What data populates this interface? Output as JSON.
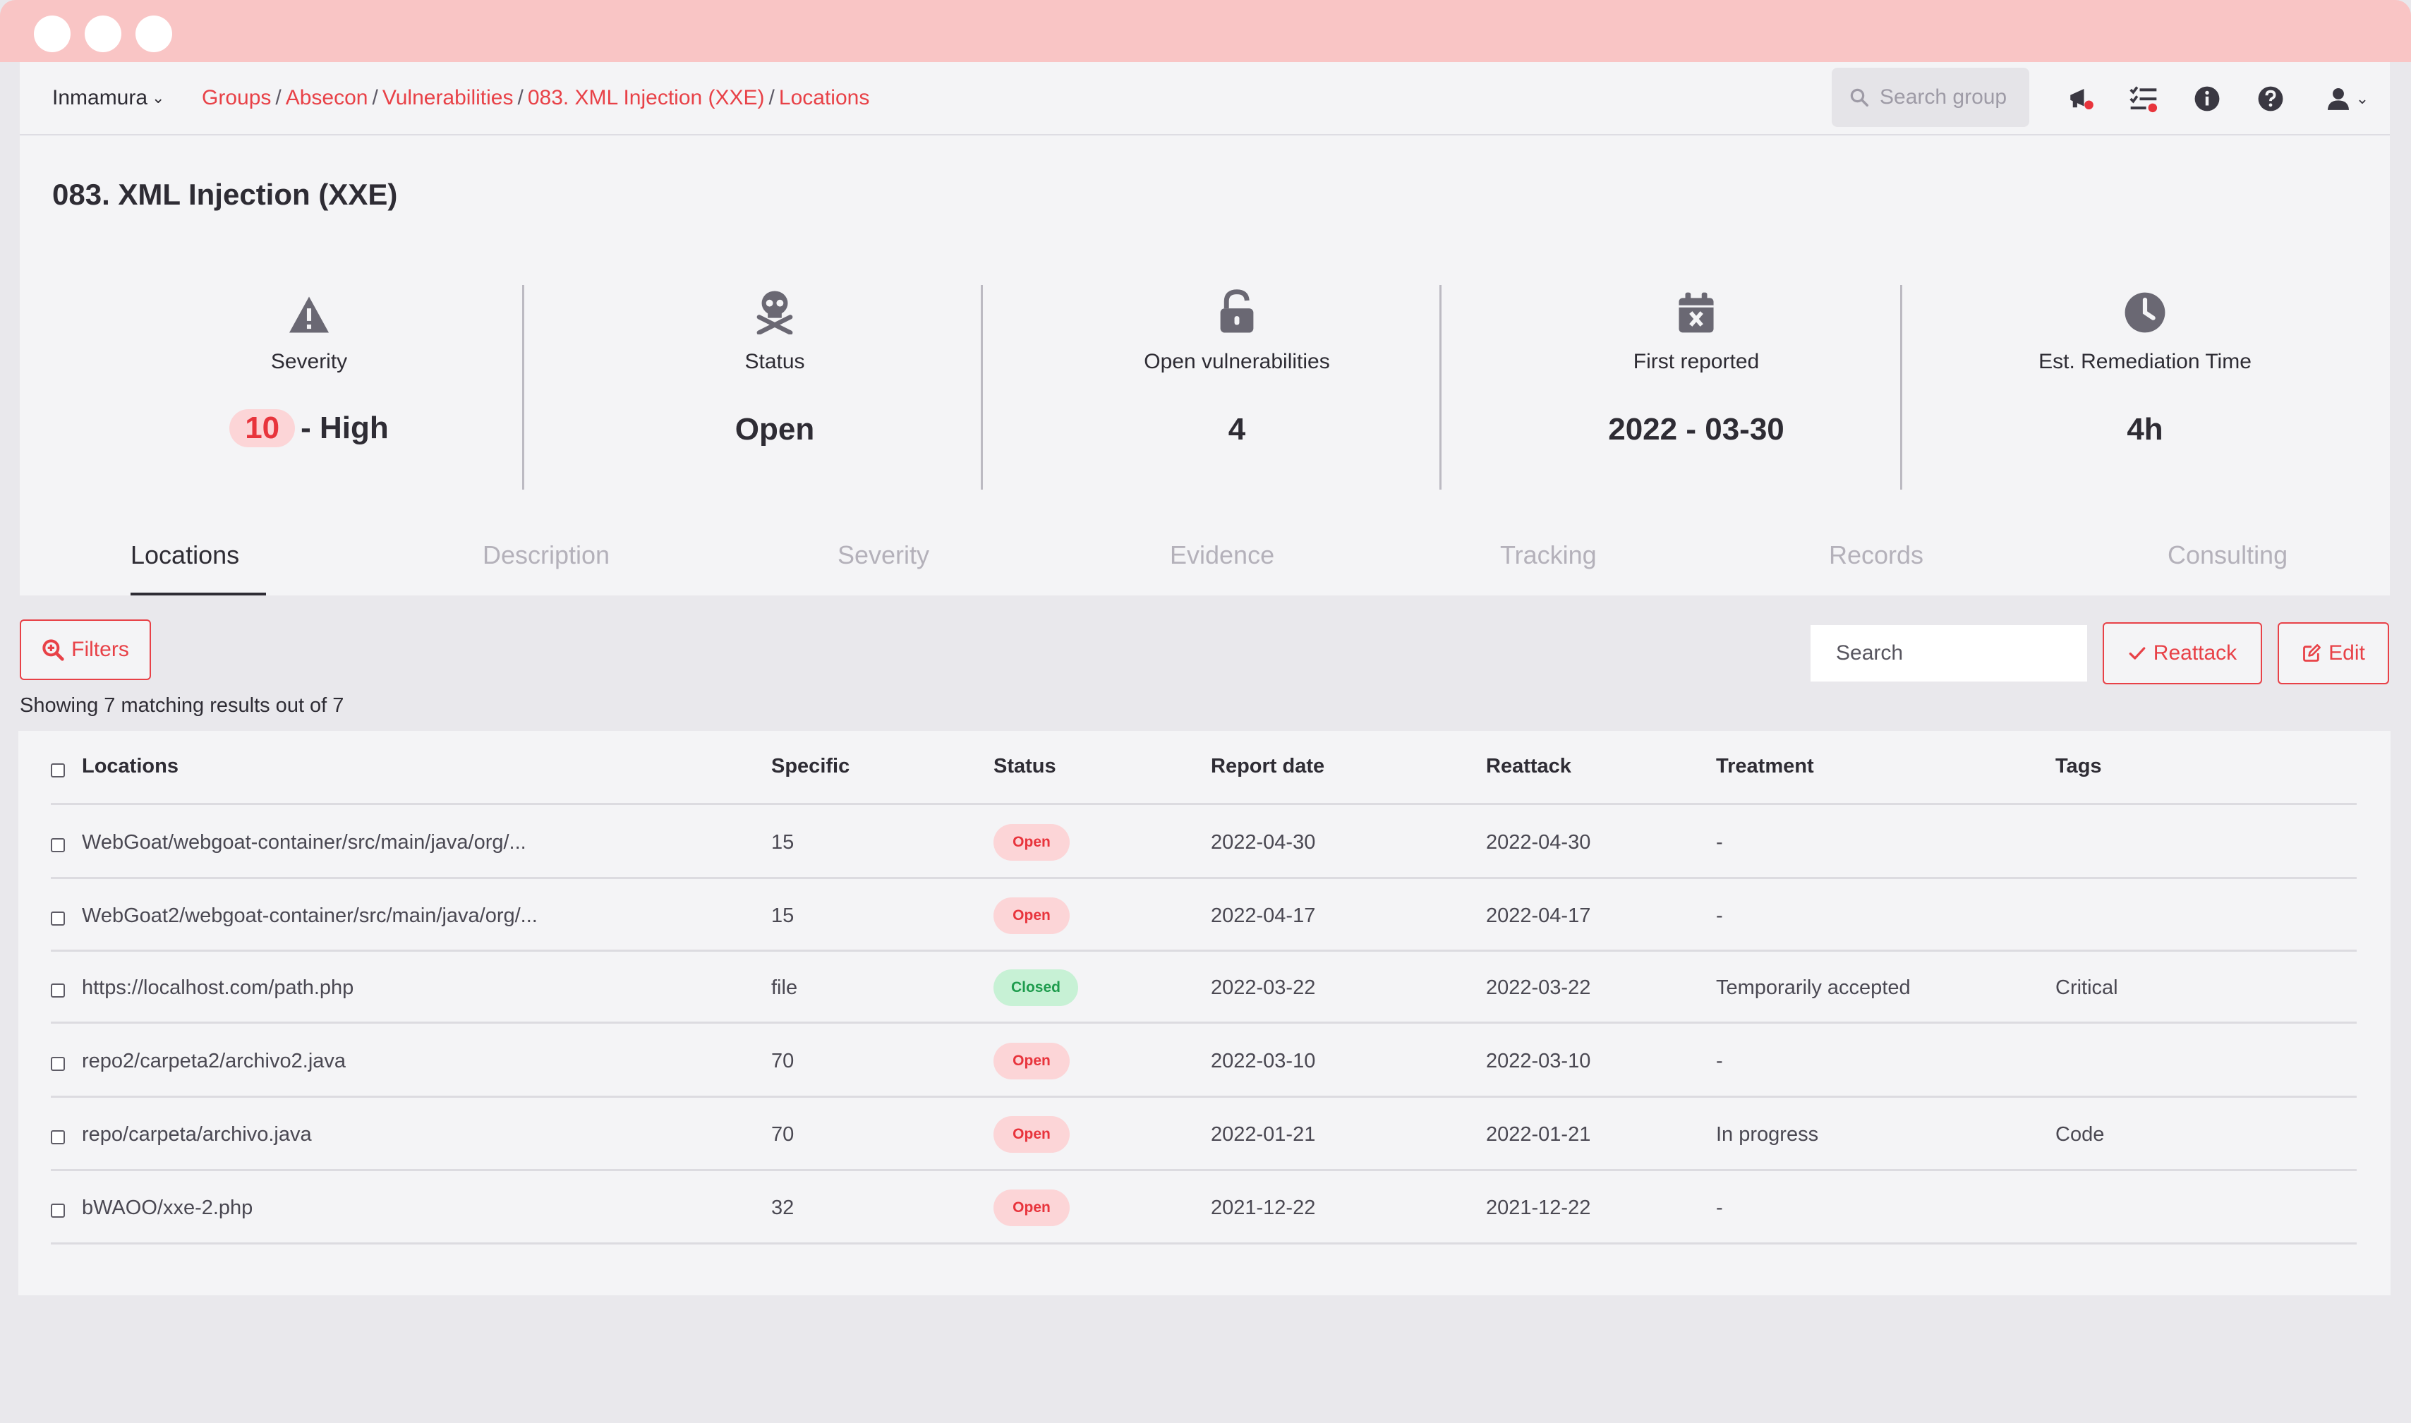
{
  "window": {
    "controls": [
      "close",
      "minimize",
      "maximize"
    ]
  },
  "topbar": {
    "organization": "Inmamura",
    "breadcrumb": [
      "Groups",
      "Absecon",
      "Vulnerabilities",
      "083. XML Injection (XXE)",
      "Locations"
    ],
    "search_placeholder": "Search group",
    "icons": [
      "announcement-icon",
      "tasks-icon",
      "info-icon",
      "help-icon",
      "user-icon"
    ]
  },
  "vulnerability": {
    "title": "083. XML Injection (XXE)",
    "indicators": {
      "severity": {
        "label": "Severity",
        "score": "10",
        "level": "- High"
      },
      "status": {
        "label": "Status",
        "value": "Open"
      },
      "open_vulns": {
        "label": "Open vulnerabilities",
        "value": "4"
      },
      "first_reported": {
        "label": "First reported",
        "value": "2022 - 03-30"
      },
      "remediation": {
        "label": "Est. Remediation Time",
        "value": "4h"
      }
    }
  },
  "tabs": [
    "Locations",
    "Description",
    "Severity",
    "Evidence",
    "Tracking",
    "Records",
    "Consulting"
  ],
  "active_tab": "Locations",
  "toolbar": {
    "filters_label": "Filters",
    "results_text": "Showing 7 matching results out of 7",
    "search_placeholder": "Search",
    "reattack_label": "Reattack",
    "edit_label": "Edit"
  },
  "table": {
    "columns": [
      "Locations",
      "Specific",
      "Status",
      "Report date",
      "Reattack",
      "Treatment",
      "Tags"
    ],
    "rows": [
      {
        "location": "WebGoat/webgoat-container/src/main/java/org/...",
        "specific": "15",
        "status": "Open",
        "report_date": "2022-04-30",
        "reattack": "2022-04-30",
        "treatment": "-",
        "tags": ""
      },
      {
        "location": "WebGoat2/webgoat-container/src/main/java/org/...",
        "specific": "15",
        "status": "Open",
        "report_date": "2022-04-17",
        "reattack": "2022-04-17",
        "treatment": "-",
        "tags": ""
      },
      {
        "location": "https://localhost.com/path.php",
        "specific": "file",
        "status": "Closed",
        "report_date": "2022-03-22",
        "reattack": "2022-03-22",
        "treatment": "Temporarily accepted",
        "tags": "Critical"
      },
      {
        "location": "repo2/carpeta2/archivo2.java",
        "specific": "70",
        "status": "Open",
        "report_date": "2022-03-10",
        "reattack": "2022-03-10",
        "treatment": "-",
        "tags": ""
      },
      {
        "location": "repo/carpeta/archivo.java",
        "specific": "70",
        "status": "Open",
        "report_date": "2022-01-21",
        "reattack": "2022-01-21",
        "treatment": "In progress",
        "tags": "Code"
      },
      {
        "location": "bWAOO/xxe-2.php",
        "specific": "32",
        "status": "Open",
        "report_date": "2021-12-22",
        "reattack": "2021-12-22",
        "treatment": "-",
        "tags": ""
      }
    ]
  },
  "colors": {
    "accent": "#e84147",
    "window_bar": "#f9c5c5",
    "open_badge": "#fcd5d7",
    "closed_badge": "#c7f1d5"
  }
}
